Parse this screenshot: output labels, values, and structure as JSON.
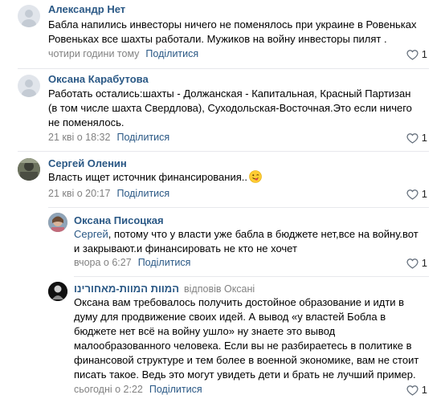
{
  "comments": [
    {
      "author": "Александр Нет",
      "lines": [
        "Бабла напились инвесторы ничего не поменялось при украине в Ровеньках",
        "Ровеньках все шахты работали. Мужиков на войну инвесторы пилят ."
      ],
      "time": "чотири години тому",
      "share": "Поділитися",
      "likes": "1"
    },
    {
      "author": "Оксана Карабутова",
      "lines": [
        "Работать остались:шахты - Должанская - Капитальная, Красный Партизан",
        "(в том числе шахта Свердлова), Суходольская-Восточная.Это если ничего",
        "не поменялось."
      ],
      "time": "21 кві о 18:32",
      "share": "Поділитися",
      "likes": "1"
    },
    {
      "author": "Сергей Оленин",
      "lines": [
        "Власть ищет источник финансирования.."
      ],
      "time": "21 кві о 20:17",
      "share": "Поділитися",
      "likes": "1"
    },
    {
      "author": "Оксана Писоцкая",
      "mention": "Сергей",
      "lines": [
        ", потому что у власти уже бабла в бюджете нет,все на войну.вот",
        "и закрывают.и финансировать не кто не хочет"
      ],
      "time": "вчора о 6:27",
      "share": "Поділитися",
      "likes": "1"
    },
    {
      "author": "המוות המוות-מאחורינו",
      "reply_to": "відповів Оксані",
      "lines": [
        "Оксана вам требовалось получить достойное образование и идти в",
        "думу для продвижение своих идей. А вывод «у властей Бобла в",
        "бюджете нет всё на войну ушло» ну знаете это вывод",
        "малообразованного человека. Если вы не разбираетесь в политике в",
        "финансовой структуре и тем более в военной экономике, вам не стоит",
        "писать такое. Ведь это могут увидеть дети и брать не лучший пример."
      ],
      "time": "сьогодні о 2:22",
      "share": "Поділитися",
      "likes": "1"
    }
  ],
  "icons": {
    "like": "heart-outline-icon",
    "emoji": "winking-tongue-emoji-icon"
  },
  "colors": {
    "link": "#2a5885",
    "meta": "#828282",
    "separator": "#e7e8ec"
  }
}
